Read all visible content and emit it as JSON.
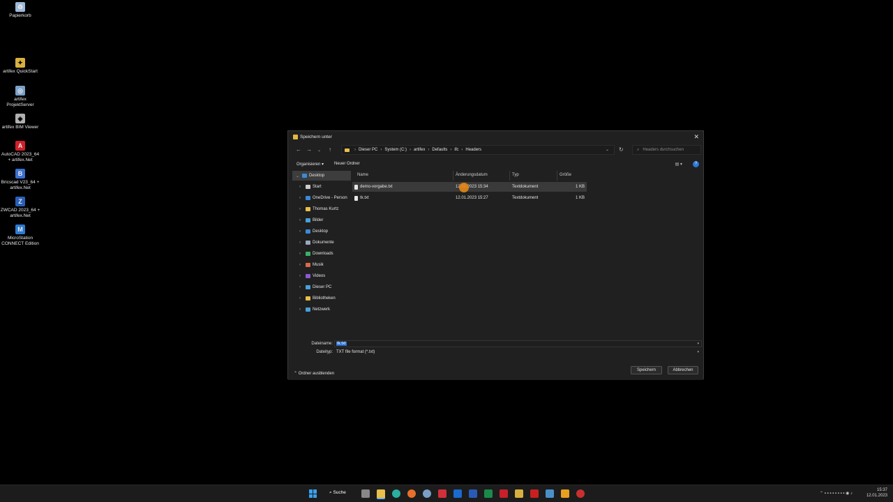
{
  "desktop": {
    "icons": [
      {
        "label": "Papierkorb",
        "icon": "recycle-bin-icon",
        "color": "#9fb8d8"
      },
      {
        "label": "artifex QuickStart",
        "icon": "quickstart-icon",
        "color": "#d8b040"
      },
      {
        "label": "artifex ProjektServer",
        "icon": "projektserver-icon",
        "color": "#7aa0c8"
      },
      {
        "label": "artifex BIM Viewer",
        "icon": "bim-viewer-icon",
        "color": "#b0b0b0"
      },
      {
        "label": "AutoCAD 2023_64 + artifex.Net",
        "icon": "autocad-icon",
        "color": "#d0202a"
      },
      {
        "label": "Bricscad V23_64 + artifex.Net",
        "icon": "bricscad-icon",
        "color": "#3a6fd0"
      },
      {
        "label": "ZWCAD 2023_64 + artifex.Net",
        "icon": "zwcad-icon",
        "color": "#2a5fb8"
      },
      {
        "label": "MicroStation CONNECT Edition",
        "icon": "microstation-icon",
        "color": "#2a7ad0"
      }
    ]
  },
  "dialog": {
    "title": "Speichern unter",
    "close": "✕",
    "address": {
      "crumbs": [
        "Dieser PC",
        "System (C:)",
        "artifex",
        "Defaults",
        "ifc",
        "Headers"
      ]
    },
    "search_placeholder": "Headers durchsuchen",
    "toolbar": {
      "organize": "Organisieren ▾",
      "new_folder": "Neuer Ordner",
      "help": "?"
    },
    "nav": [
      {
        "label": "Desktop",
        "icon": "desktop-icon",
        "color": "#3a8ad8",
        "expanded": true
      },
      {
        "label": "Start",
        "icon": "home-icon",
        "color": "#cccccc"
      },
      {
        "label": "OneDrive - Person",
        "icon": "onedrive-icon",
        "color": "#3a8ad8"
      },
      {
        "label": "Thomas Kurtz",
        "icon": "user-folder-icon",
        "color": "#e8c04a"
      },
      {
        "label": "Bilder",
        "icon": "pictures-icon",
        "color": "#4aa0d8"
      },
      {
        "label": "Desktop",
        "icon": "desktop-icon",
        "color": "#3a8ad8"
      },
      {
        "label": "Dokumente",
        "icon": "documents-icon",
        "color": "#9aa8c0"
      },
      {
        "label": "Downloads",
        "icon": "downloads-icon",
        "color": "#3ab06a"
      },
      {
        "label": "Musik",
        "icon": "music-icon",
        "color": "#d86a4a"
      },
      {
        "label": "Videos",
        "icon": "videos-icon",
        "color": "#8a5ad0"
      },
      {
        "label": "Dieser PC",
        "icon": "this-pc-icon",
        "color": "#4aa0d8"
      },
      {
        "label": "Bibliotheken",
        "icon": "libraries-icon",
        "color": "#e8c04a"
      },
      {
        "label": "Netzwerk",
        "icon": "network-icon",
        "color": "#4aa0d8"
      }
    ],
    "columns": {
      "name": "Name",
      "date": "Änderungsdatum",
      "type": "Typ",
      "size": "Größe"
    },
    "files": [
      {
        "name": "demo-vorgabe.txt",
        "date": "12.01.2023 15:34",
        "type": "Textdokument",
        "size": "1 KB"
      },
      {
        "name": "tk.txt",
        "date": "12.01.2023 15:27",
        "type": "Textdokument",
        "size": "1 KB"
      }
    ],
    "filename_label": "Dateiname:",
    "filename_value": "tk.txt",
    "filetype_label": "Dateityp:",
    "filetype_value": "TXT file format (*.txt)",
    "save_button": "Speichern",
    "cancel_button": "Abbrechen",
    "hide_folders": "Ordner ausblenden"
  },
  "taskbar": {
    "search_label": "Suche",
    "time": "15:37",
    "date": "12.01.2023",
    "apps": [
      {
        "icon": "task-view-icon",
        "color": "#888888"
      },
      {
        "icon": "file-explorer-icon",
        "color": "#e8c04a"
      },
      {
        "icon": "edge-icon",
        "color": "#2ab0a0"
      },
      {
        "icon": "firefox-icon",
        "color": "#e8702a"
      },
      {
        "icon": "settings-icon",
        "color": "#7aa0c8"
      },
      {
        "icon": "app-red-icon",
        "color": "#d0303a"
      },
      {
        "icon": "outlook-icon",
        "color": "#1a6ad0"
      },
      {
        "icon": "word-icon",
        "color": "#2a5ab8"
      },
      {
        "icon": "excel-icon",
        "color": "#1a8a4a"
      },
      {
        "icon": "acrobat-icon",
        "color": "#c8202a"
      },
      {
        "icon": "keepass-icon",
        "color": "#d8b040"
      },
      {
        "icon": "filezilla-icon",
        "color": "#c82020"
      },
      {
        "icon": "image-viewer-icon",
        "color": "#4a90c8"
      },
      {
        "icon": "snip-icon",
        "color": "#e8a020"
      },
      {
        "icon": "recorder-icon",
        "color": "#c83030"
      }
    ]
  }
}
